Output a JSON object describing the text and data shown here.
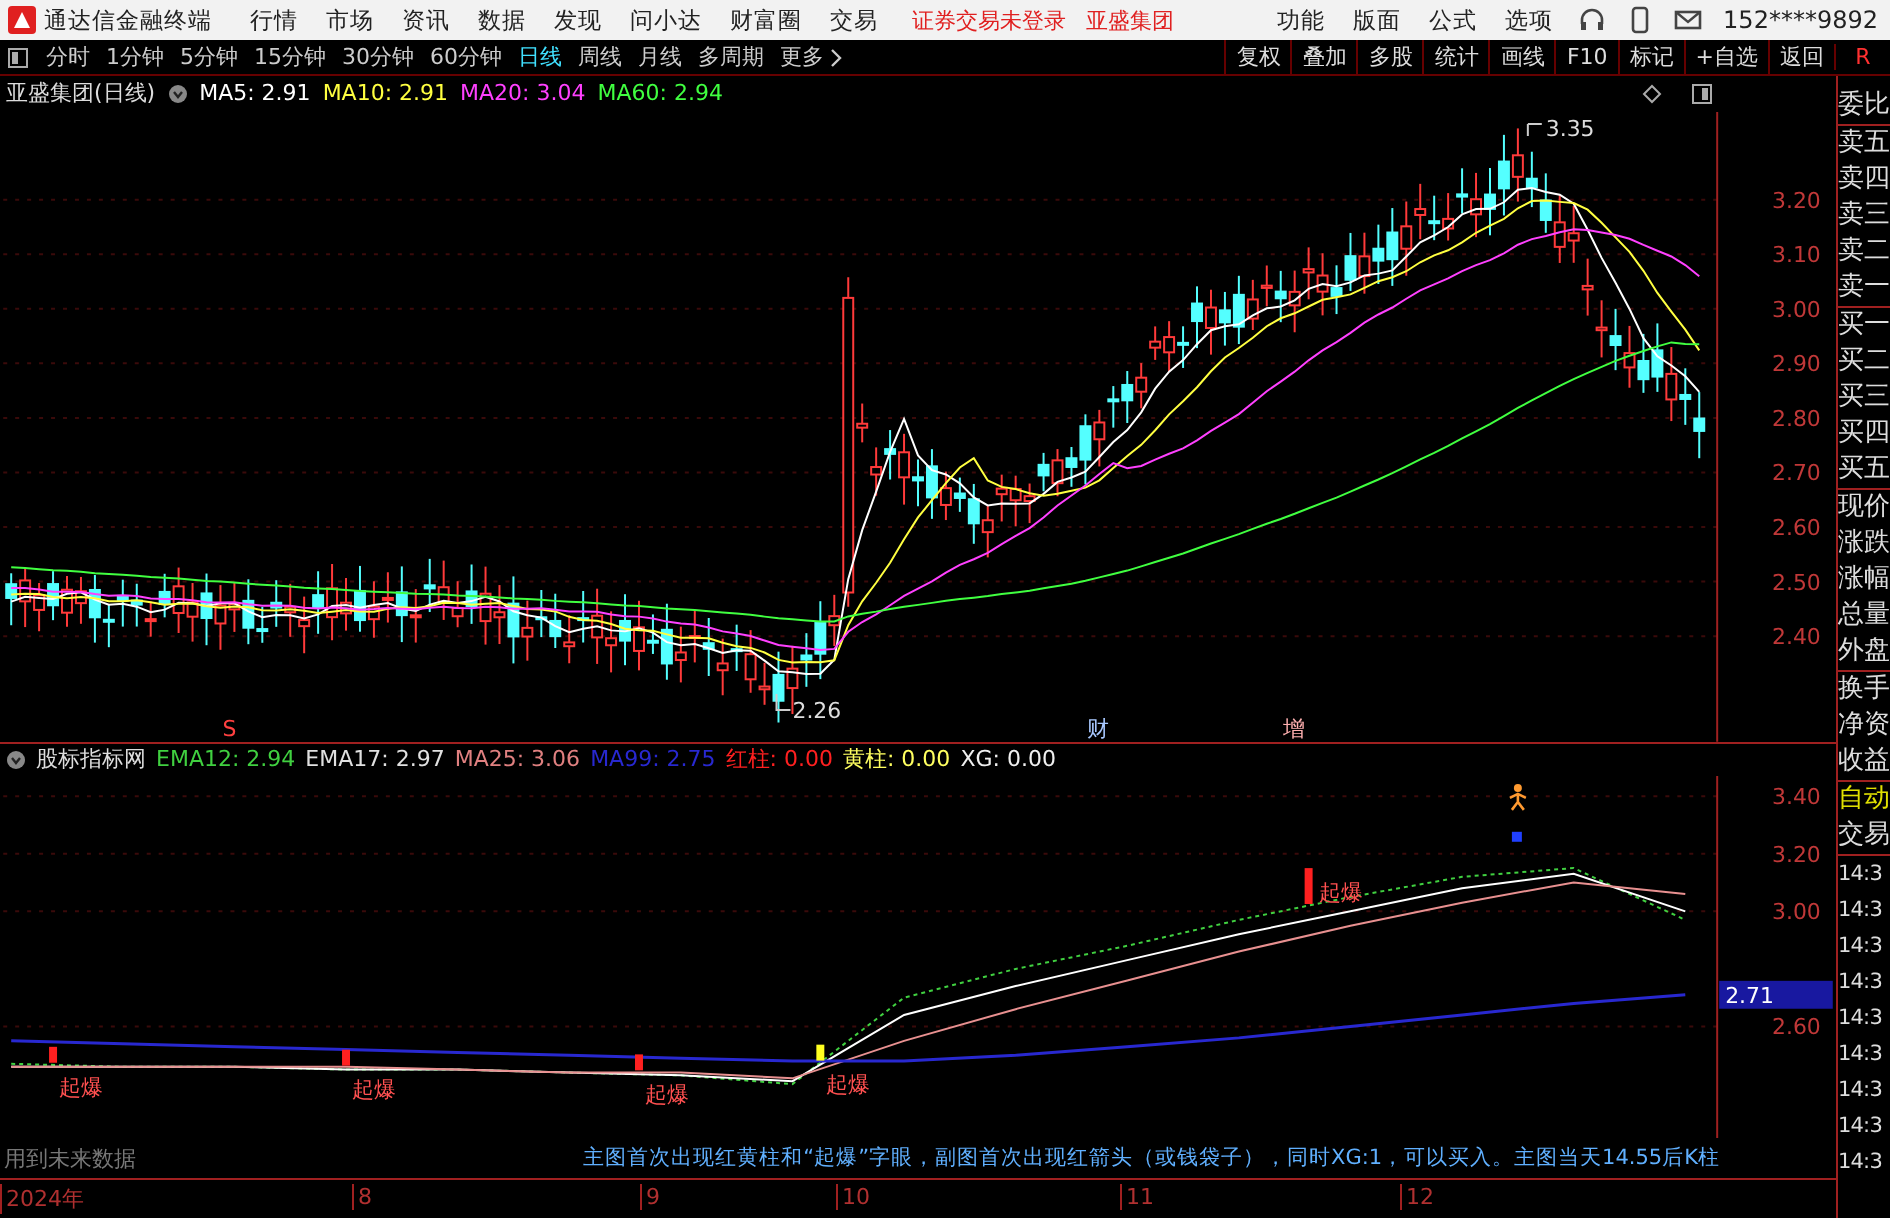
{
  "app_bar": {
    "title": "通达信金融终端",
    "menu": [
      "行情",
      "市场",
      "资讯",
      "数据",
      "发现",
      "问小达",
      "财富圈",
      "交易"
    ],
    "notices": [
      "证券交易未登录",
      "亚盛集团"
    ],
    "tools": [
      "功能",
      "版面",
      "公式",
      "选项"
    ],
    "account": "152****9892"
  },
  "period_tabs": [
    {
      "label": "分时",
      "selected": false
    },
    {
      "label": "1分钟",
      "selected": false
    },
    {
      "label": "5分钟",
      "selected": false
    },
    {
      "label": "15分钟",
      "selected": false
    },
    {
      "label": "30分钟",
      "selected": false
    },
    {
      "label": "60分钟",
      "selected": false
    },
    {
      "label": "日线",
      "selected": true
    },
    {
      "label": "周线",
      "selected": false
    },
    {
      "label": "月线",
      "selected": false
    },
    {
      "label": "多周期",
      "selected": false
    },
    {
      "label": "更多",
      "selected": false
    }
  ],
  "toolbar_buttons": [
    "复权",
    "叠加",
    "多股",
    "统计",
    "画线",
    "F10",
    "标记",
    "+自选",
    "返回"
  ],
  "corner_label": "R",
  "main_chart": {
    "title": "亚盛集团(日线)",
    "indicators": [
      {
        "label": "MA5: 2.91",
        "color": "#ffffff"
      },
      {
        "label": "MA10: 2.91",
        "color": "#ffff40"
      },
      {
        "label": "MA20: 3.04",
        "color": "#ff40ff"
      },
      {
        "label": "MA60: 2.94",
        "color": "#40ff40"
      }
    ],
    "price_ticks": [
      "3.20",
      "3.10",
      "3.00",
      "2.90",
      "2.80",
      "2.70",
      "2.60",
      "2.50",
      "2.40"
    ],
    "high_label": "3.35",
    "low_label": "2.26",
    "event_marks": [
      {
        "text": "S",
        "color": "#ff4040"
      },
      {
        "text": "财",
        "color": "#a8c8ff"
      },
      {
        "text": "增",
        "color": "#ffb0b0"
      }
    ]
  },
  "sub_chart": {
    "title": "股标指标网",
    "indicators": [
      {
        "label": "EMA12: 2.94",
        "color": "#40d040"
      },
      {
        "label": "EMA17: 2.97",
        "color": "#e0e0e0"
      },
      {
        "label": "MA25: 3.06",
        "color": "#e08080"
      },
      {
        "label": "MA99: 2.75",
        "color": "#2828d0"
      },
      {
        "label": "红柱: 0.00",
        "color": "#ff2020"
      },
      {
        "label": "黄柱: 0.00",
        "color": "#ffff60"
      },
      {
        "label": "XG: 0.00",
        "color": "#f0f0f0"
      }
    ],
    "chart_data": {
      "type": "line",
      "grid": true,
      "ylim": [
        2.21,
        3.47
      ],
      "yticks": [
        {
          "value": 3.4,
          "label": "3.40"
        },
        {
          "value": 3.2,
          "label": "3.20"
        },
        {
          "value": 3.0,
          "label": "3.00"
        },
        {
          "value": 2.6,
          "label": "2.60"
        }
      ],
      "series": [
        {
          "line_style": "dashed",
          "color": "#40d040",
          "values": [
            2.47,
            2.46,
            2.46,
            2.45,
            2.45,
            2.44,
            2.43,
            2.4,
            2.7,
            2.8,
            2.88,
            2.97,
            3.05,
            3.12,
            3.15,
            2.97
          ]
        },
        {
          "line_style": "solid",
          "color": "#ffffff",
          "values": [
            2.46,
            2.46,
            2.46,
            2.45,
            2.45,
            2.44,
            2.43,
            2.41,
            2.64,
            2.74,
            2.83,
            2.92,
            3.0,
            3.08,
            3.13,
            3.0
          ]
        },
        {
          "line_style": "solid",
          "color": "#e89090",
          "values": [
            2.46,
            2.46,
            2.46,
            2.46,
            2.45,
            2.44,
            2.44,
            2.42,
            2.55,
            2.66,
            2.76,
            2.86,
            2.95,
            3.03,
            3.1,
            3.06
          ]
        },
        {
          "line_style": "solid",
          "color": "#2828d0",
          "values": [
            2.55,
            2.54,
            2.53,
            2.52,
            2.51,
            2.5,
            2.49,
            2.48,
            2.48,
            2.5,
            2.53,
            2.56,
            2.6,
            2.64,
            2.68,
            2.71
          ]
        }
      ]
    },
    "current_value": "2.71",
    "signal_labels": [
      "起爆",
      "起爆",
      "起爆",
      "起爆",
      "起爆"
    ]
  },
  "side_panel": {
    "quote_labels": [
      "委比",
      "卖五",
      "卖四",
      "卖三",
      "卖二",
      "卖一",
      "买一",
      "买二",
      "买三",
      "买四",
      "买五",
      "现价",
      "涨跌",
      "涨幅",
      "总量",
      "外盘",
      "换手",
      "净资",
      "收益"
    ],
    "trade_labels": [
      "自动",
      "交易"
    ],
    "times": [
      "14:3",
      "14:3",
      "14:3",
      "14:3",
      "14:3",
      "14:3",
      "14:3",
      "14:3",
      "14:3"
    ]
  },
  "footer": {
    "warning": "用到未来数据",
    "description": "主图首次出现红黄柱和“起爆”字眼，副图首次出现红箭头（或钱袋子），同时XG:1，可以买入。主图当天14.55后K柱",
    "dates": [
      "2024年",
      "8",
      "9",
      "10",
      "11",
      "12"
    ]
  }
}
